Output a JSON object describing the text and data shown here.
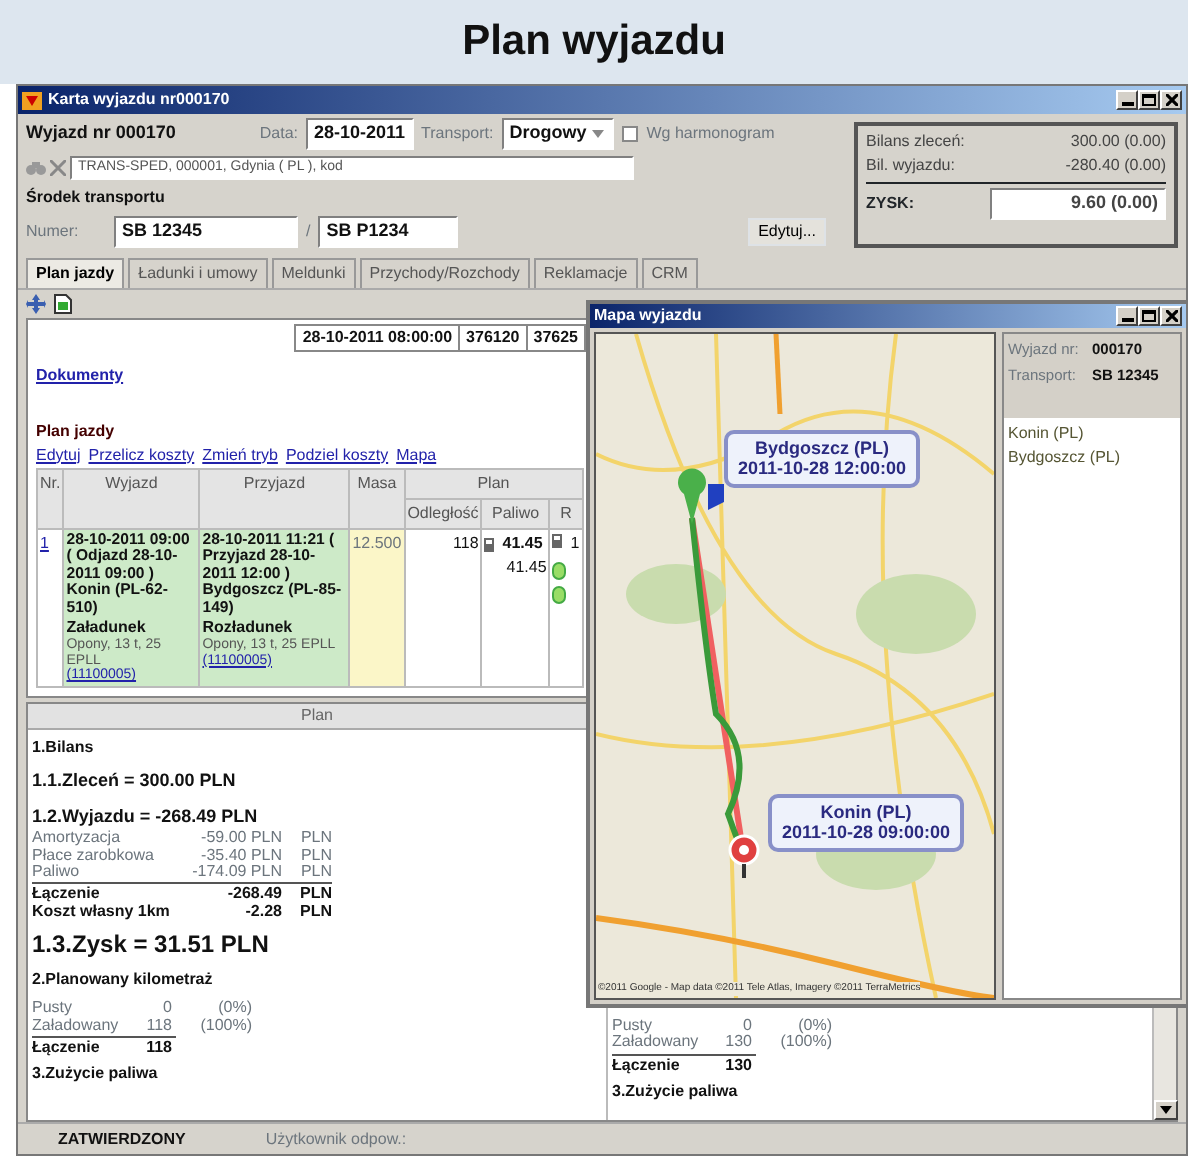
{
  "heading": "Plan wyjazdu",
  "window": {
    "title": "Karta wyjazdu nr000170"
  },
  "header": {
    "trip": "Wyjazd nr 000170",
    "date_label": "Data:",
    "date": "28-10-2011",
    "transport_label": "Transport:",
    "transport": "Drogowy",
    "schedule": {
      "label": "Wg harmonogram",
      "checked": false
    },
    "contractor": "TRANS-SPED, 000001, Gdynia ( PL ), kod",
    "vehicle_heading": "Środek transportu",
    "number_label": "Numer:",
    "vehicle": "SB 12345",
    "separator": "/",
    "trailer": "SB P1234",
    "edit_button": "Edytuj..."
  },
  "balance": {
    "rows": [
      {
        "label": "Bilans zleceń:",
        "value": "300.00 (0.00)"
      },
      {
        "label": "Bil. wyjazdu:",
        "value": "-280.40 (0.00)"
      }
    ],
    "profit_label": "ZYSK:",
    "profit": "9.60 (0.00)"
  },
  "tabs": [
    {
      "label": "Plan jazdy",
      "selected": true
    },
    {
      "label": "Ładunki i umowy",
      "selected": false
    },
    {
      "label": "Meldunki",
      "selected": false
    },
    {
      "label": "Przychody/Rozchody",
      "selected": false
    },
    {
      "label": "Reklamacje",
      "selected": false
    },
    {
      "label": "CRM",
      "selected": false
    }
  ],
  "summary_strip": [
    "28-10-2011 08:00:00",
    "376120",
    "37625"
  ],
  "documents_link": "Dokumenty",
  "plan_heading": "Plan jazdy",
  "plan_actions": [
    "Edytuj",
    "Przelicz koszty",
    "Zmień tryb",
    "Podziel koszty",
    "Mapa"
  ],
  "table": {
    "columns": [
      "Nr.",
      "Wyjazd",
      "Przyjazd",
      "Masa"
    ],
    "group": "Plan",
    "subcolumns": [
      "Odległość",
      "Paliwo",
      "R"
    ],
    "rows": [
      {
        "nr": "1",
        "departure": {
          "main": "28-10-2011 09:00 ( Odjazd 28-10-2011 09:00 ) Konin (PL-62-510)",
          "action": "Załadunek",
          "cargo": "Opony, 13 t, 25 EPLL",
          "order": "(11100005)"
        },
        "arrival": {
          "main": "28-10-2011 11:21 ( Przyjazd 28-10-2011 12:00 ) Bydgoszcz (PL-85-149)",
          "action": "Rozładunek",
          "cargo": "Opony, 13 t, 25 EPLL",
          "order": "(11100005)"
        },
        "mass": "12.500",
        "distance": "118",
        "fuel": {
          "planned": "41.45",
          "actual": "41.45"
        },
        "column_7": "1"
      }
    ]
  },
  "plan": {
    "title": "Plan",
    "sections": [
      {
        "kind": "heading",
        "text": "1.Bilans"
      },
      {
        "kind": "subheading",
        "text": "1.1.Zleceń = 300.00 PLN"
      },
      {
        "kind": "subheading",
        "text": "1.2.Wyjazdu = -268.49 PLN"
      },
      {
        "kind": "costs",
        "rows": [
          {
            "label": "Amortyzacja",
            "value": "-59.00 PLN",
            "unit": "PLN"
          },
          {
            "label": "Płace zarobkowa",
            "value": "-35.40 PLN",
            "unit": "PLN"
          },
          {
            "label": "Paliwo",
            "value": "-174.09 PLN",
            "unit": "PLN"
          }
        ],
        "totals": [
          {
            "label": "Łączenie",
            "value": "-268.49",
            "unit": "PLN"
          },
          {
            "label": "Koszt własny 1km",
            "value": "-2.28",
            "unit": "PLN"
          }
        ]
      },
      {
        "kind": "big",
        "text": "1.3.Zysk = 31.51 PLN"
      },
      {
        "kind": "heading",
        "text": "2.Planowany kilometraż"
      },
      {
        "kind": "km",
        "rows": [
          {
            "label": "Pusty",
            "value": "0",
            "share": "(0%)"
          },
          {
            "label": "Załadowany",
            "value": "118",
            "share": "(100%)"
          }
        ],
        "total": {
          "label": "Łączenie",
          "value": "118"
        }
      },
      {
        "kind": "heading",
        "text": "3.Zużycie paliwa"
      }
    ],
    "second_column": [
      {
        "kind": "km",
        "rows": [
          {
            "label": "Pusty",
            "value": "0",
            "share": "(0%)"
          },
          {
            "label": "Załadowany",
            "value": "130",
            "share": "(100%)"
          }
        ],
        "total": {
          "label": "Łączenie",
          "value": "130"
        }
      },
      {
        "kind": "heading",
        "text": "3.Zużycie paliwa"
      }
    ]
  },
  "status_bar": {
    "state": "ZATWIERDZONY",
    "user_label": "Użytkownik odpow.:"
  },
  "map_window": {
    "title": "Mapa wyjazdu",
    "callouts": [
      {
        "place": "Bydgoszcz (PL)",
        "time": "2011-10-28 12:00:00"
      },
      {
        "place": "Konin (PL)",
        "time": "2011-10-28 09:00:00"
      }
    ],
    "attribution": "©2011 Google - Map data ©2011 Tele Atlas, Imagery ©2011 TerraMetrics",
    "info": [
      {
        "label": "Wyjazd nr:",
        "value": "000170"
      },
      {
        "label": "Transport:",
        "value": "SB 12345"
      }
    ],
    "stops": [
      "Konin (PL)",
      "Bydgoszcz (PL)"
    ]
  }
}
